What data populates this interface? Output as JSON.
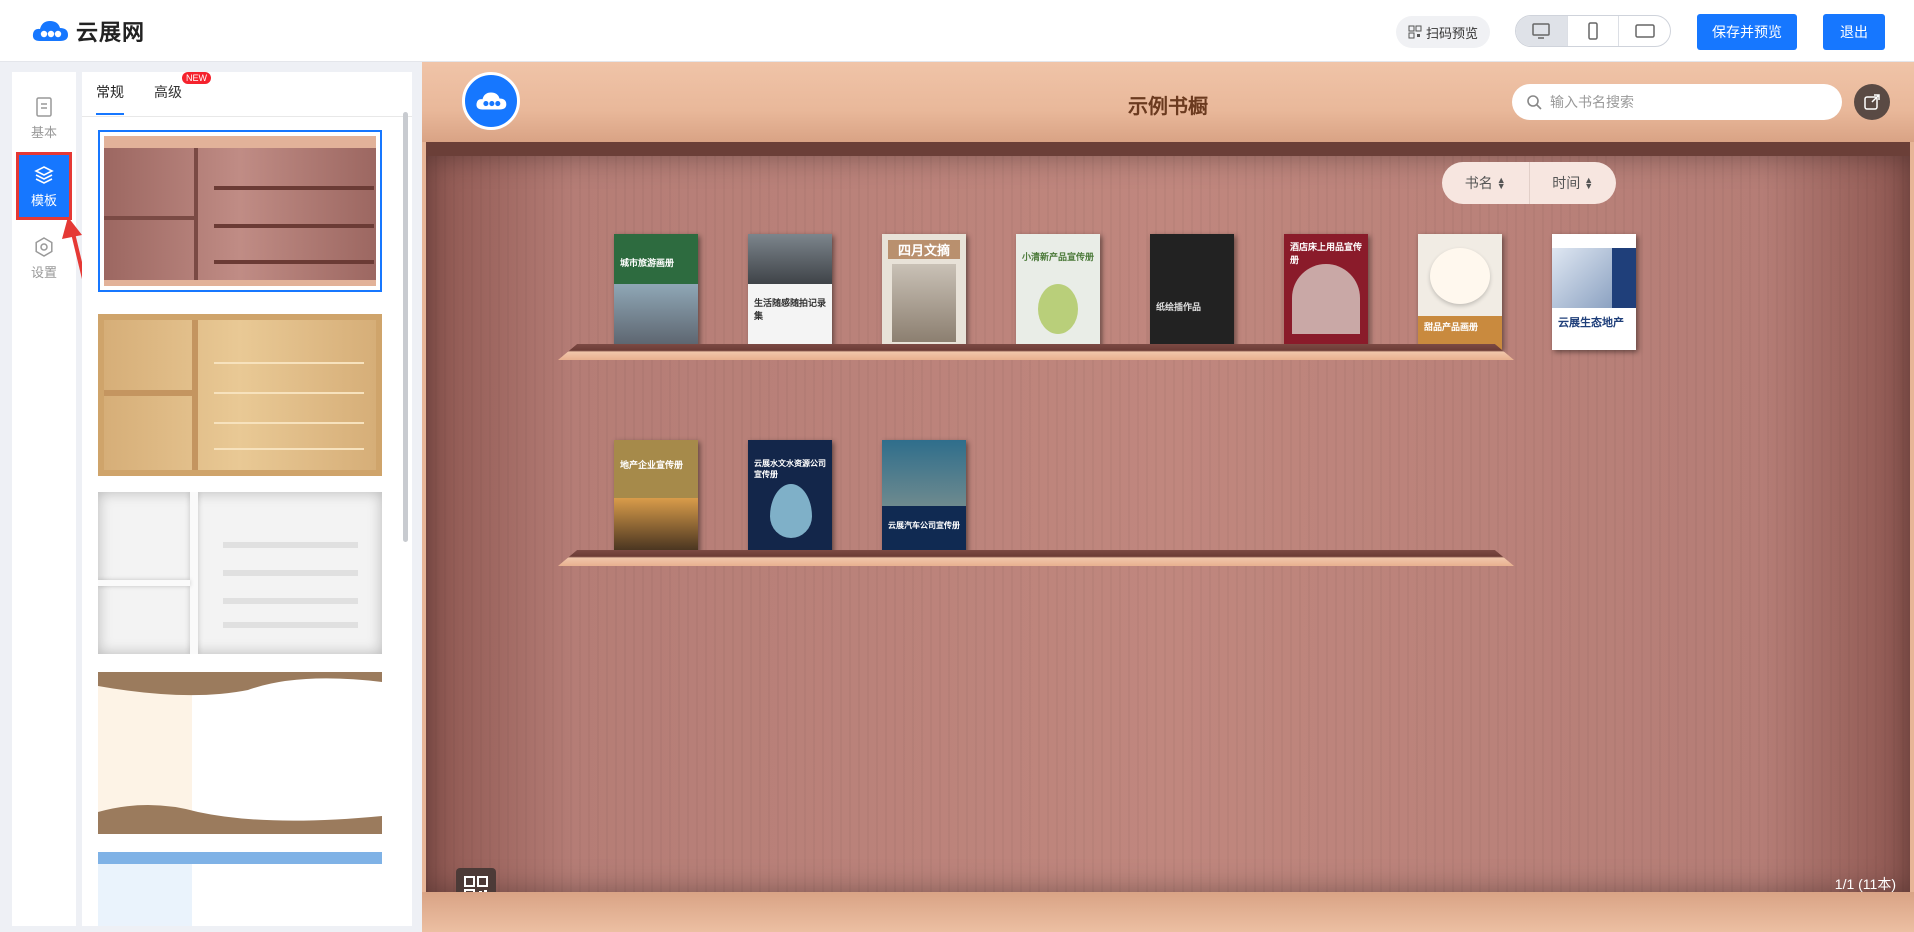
{
  "header": {
    "app_name": "云展网",
    "scan_preview": "扫码预览",
    "save_preview": "保存并预览",
    "exit": "退出",
    "devices": [
      "desktop-icon",
      "mobile-icon",
      "tablet-icon"
    ],
    "active_device": "desktop"
  },
  "rail": {
    "items": [
      {
        "label": "基本",
        "icon": "document-icon"
      },
      {
        "label": "模板",
        "icon": "layers-icon",
        "active": true
      },
      {
        "label": "设置",
        "icon": "gear-icon"
      }
    ]
  },
  "templates": {
    "tabs": [
      {
        "label": "常规",
        "active": true
      },
      {
        "label": "高级",
        "badge": "NEW"
      }
    ],
    "items": [
      "rosewood",
      "light-wood",
      "white",
      "cream-wave",
      "blue-sky"
    ],
    "selected": "rosewood"
  },
  "preview": {
    "title": "示例书橱",
    "search_placeholder": "输入书名搜索",
    "sort_name": "书名",
    "sort_time": "时间",
    "page_count": "1/1 (11本)",
    "books": [
      {
        "title": "城市旅游画册",
        "bg": "#2d6b3f"
      },
      {
        "title": "生活随感随拍记录集",
        "bg": "#f4f4f4"
      },
      {
        "title": "四月文摘",
        "bg": "#e8e2d8"
      },
      {
        "title": "小清新产品宣传册",
        "bg": "#e9ede7"
      },
      {
        "title": "纸绘插作品",
        "bg": "#222222"
      },
      {
        "title": "酒店床上用品宣传册",
        "bg": "#8a1b2a"
      },
      {
        "title": "甜品产品画册",
        "bg": "#f1ece4"
      },
      {
        "title": "云展生态地产",
        "bg": "#ffffff"
      },
      {
        "title": "地产企业宣传册",
        "bg": "#a68a4a"
      },
      {
        "title": "云展水文水资源公司宣传册",
        "bg": "#13264a"
      },
      {
        "title": "云展汽车公司宣传册",
        "bg": "#102a52"
      }
    ]
  },
  "colors": {
    "accent": "#1677ff",
    "annotation": "#e53935"
  }
}
